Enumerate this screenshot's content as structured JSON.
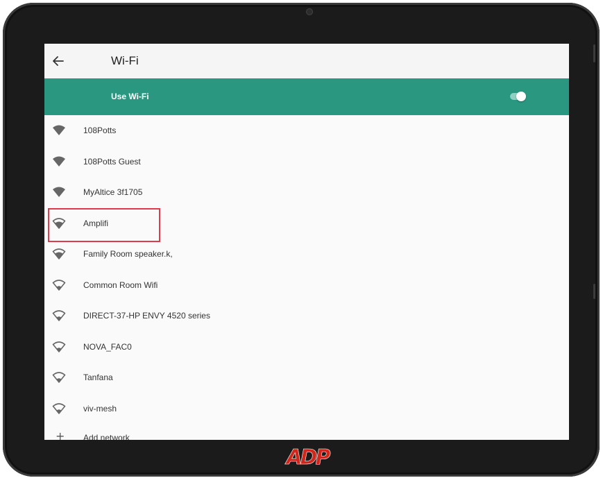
{
  "header": {
    "back_icon": "arrow-left-icon",
    "title": "Wi-Fi"
  },
  "wifi_toggle": {
    "label": "Use Wi-Fi",
    "state": "on",
    "accent_color": "#2a9880"
  },
  "networks": [
    {
      "name": "108Potts",
      "icon": "wifi-locked-full-signal-icon"
    },
    {
      "name": "108Potts Guest",
      "icon": "wifi-full-signal-icon"
    },
    {
      "name": "MyAltice 3f1705",
      "icon": "wifi-full-signal-icon"
    },
    {
      "name": "Amplifi",
      "icon": "wifi-signal-icon",
      "highlighted": true
    },
    {
      "name": "Family Room speaker.k,",
      "icon": "wifi-signal-icon"
    },
    {
      "name": "Common Room Wifi",
      "icon": "wifi-signal-icon"
    },
    {
      "name": "DIRECT-37-HP ENVY 4520 series",
      "icon": "wifi-signal-icon"
    },
    {
      "name": "NOVA_FAC0",
      "icon": "wifi-signal-icon"
    },
    {
      "name": "Tanfana",
      "icon": "wifi-signal-icon"
    },
    {
      "name": "viv-mesh",
      "icon": "wifi-signal-icon"
    }
  ],
  "add_network": {
    "label": "Add network",
    "icon": "plus-icon"
  },
  "brand": {
    "logo": "ADP",
    "color": "#d0271d"
  }
}
